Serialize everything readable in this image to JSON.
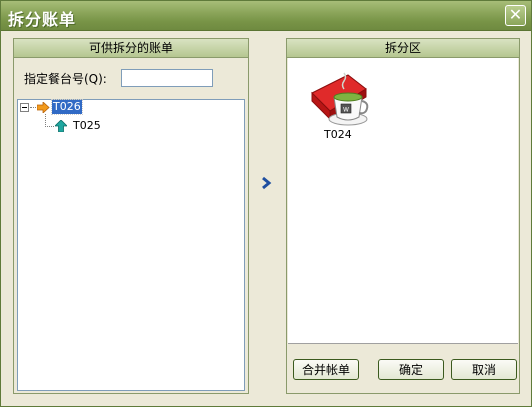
{
  "window": {
    "title": "拆分账单",
    "close_glyph": "✕"
  },
  "left_panel": {
    "header": "可供拆分的账单",
    "table_no_label": "指定餐台号(Q):",
    "table_no_value": "",
    "tree": [
      {
        "label": "T026",
        "selected": true,
        "icon": "orange-right-arrow-icon"
      },
      {
        "label": "T025",
        "selected": false,
        "icon": "teal-up-arrow-icon"
      }
    ]
  },
  "transfer_glyph": "›",
  "right_panel": {
    "header": "拆分区",
    "items": [
      {
        "label": "T024",
        "icon": "tea-cup-icon"
      }
    ],
    "buttons": {
      "merge": "合并帐单",
      "ok": "确定",
      "cancel": "取消"
    }
  },
  "colors": {
    "title_bar": "#789447",
    "selection": "#316ac5",
    "panel_bg": "#ece9d8",
    "arrow_blue": "#1f4fa0",
    "icon_red": "#d01818",
    "icon_green": "#7fb341"
  }
}
